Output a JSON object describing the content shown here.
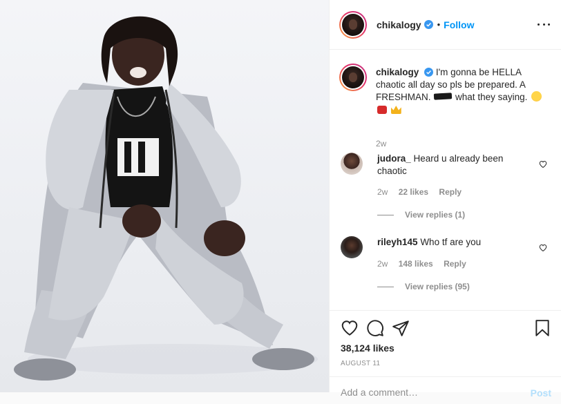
{
  "post": {
    "author": "chikalogy",
    "follow_label": "Follow",
    "separator": "•",
    "verified_color": "#3897f0",
    "accent": "#0095f6"
  },
  "caption": {
    "username": "chikalogy",
    "text_part1": "I'm gonna be HELLA chaotic all day so pls be prepared. A FRESHMAN.",
    "text_part2": "what they saying.",
    "time": "2w"
  },
  "comments": [
    {
      "username": "judora_",
      "text": "Heard u already been chaotic",
      "time": "2w",
      "likes": "22 likes",
      "reply_label": "Reply",
      "view_replies": "View replies (1)"
    },
    {
      "username": "rileyh145",
      "text": "Who tf are you",
      "time": "2w",
      "likes": "148 likes",
      "reply_label": "Reply",
      "view_replies": "View replies (95)"
    }
  ],
  "actions": {
    "icons": [
      "heart-icon",
      "comment-icon",
      "share-icon",
      "bookmark-icon"
    ],
    "likes_count": "38,124 likes",
    "date": "AUGUST 11"
  },
  "add_comment": {
    "placeholder": "Add a comment…",
    "post_label": "Post"
  }
}
